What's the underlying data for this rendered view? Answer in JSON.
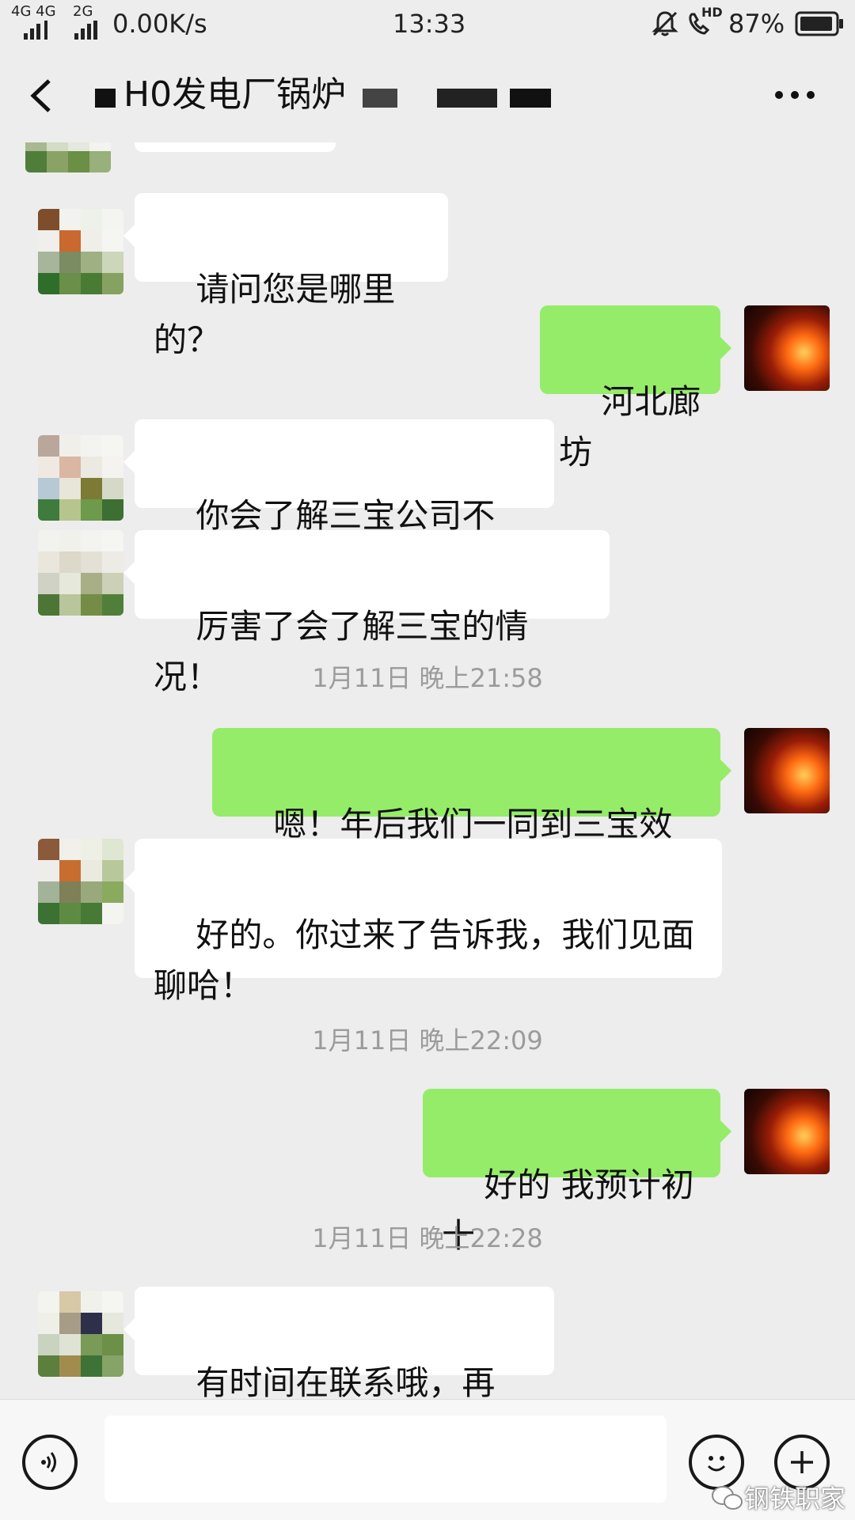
{
  "status_bar": {
    "network_left": "4G 4G",
    "network_2g": "2G",
    "speed": "0.00K/s",
    "time": "13:33",
    "hd": "HD",
    "battery": "87%"
  },
  "header": {
    "title": "H0发电厂锅炉",
    "more_icon": "more-icon",
    "back_icon": "back-icon"
  },
  "messages": [
    {
      "side": "left",
      "text": "请问您是哪里的？"
    },
    {
      "side": "right",
      "text": "河北廊坊"
    },
    {
      "side": "left",
      "text": "你会了解三宝公司不错。"
    },
    {
      "side": "left",
      "text": "厉害了会了解三宝的情况！"
    },
    {
      "type": "time",
      "text": "1月11日 晚上21:58"
    },
    {
      "side": "right",
      "text": "嗯！年后我们一同到三宝效力"
    },
    {
      "side": "left",
      "text": "好的。你过来了告诉我，我们见面\n聊哈！"
    },
    {
      "type": "time",
      "text": "1月11日 晚上22:09"
    },
    {
      "side": "right",
      "text": "好的 我预计初十"
    },
    {
      "type": "time",
      "text": "1月11日 晚上22:28"
    },
    {
      "side": "left",
      "text": "有时间在联系哦，再见。"
    }
  ],
  "input_bar": {
    "voice_icon": "voice-icon",
    "emoji_icon": "emoji-icon",
    "plus_icon": "plus-icon",
    "input_value": ""
  },
  "watermark": {
    "text": "钢铁职家"
  },
  "colors": {
    "background": "#ededed",
    "left_bubble": "#ffffff",
    "right_bubble": "#95ec69"
  }
}
